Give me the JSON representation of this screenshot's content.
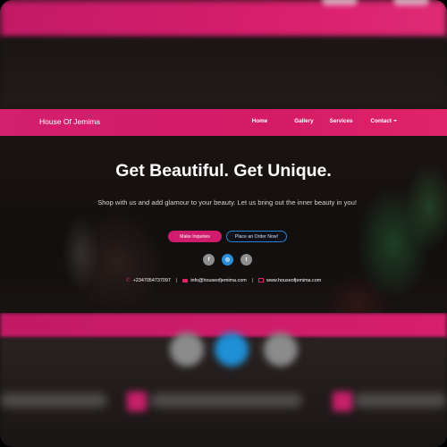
{
  "navbar": {
    "brand": "House Of Jemima",
    "links": [
      "Home",
      "Gallery",
      "Services",
      "Contact"
    ]
  },
  "hero": {
    "title": "Get Beautiful. Get Unique.",
    "subtitle": "Shop with us and add glamour to your beauty. Let us bring out the inner beauty in you!",
    "buttons": {
      "inquiries": "Make Inquiries",
      "order": "Place an Order Now!"
    }
  },
  "social": {
    "facebook": "f",
    "instagram": "◎",
    "twitter": "t"
  },
  "contact": {
    "phone": "+2347054737097",
    "separator": "|",
    "email": "info@houseofjemima.com",
    "website": "www.houseofjemima.com"
  },
  "icons": {
    "phone": "phone-icon",
    "email": "envelope-icon",
    "website": "desktop-icon"
  },
  "colors": {
    "brand_pink": "#d21f6e",
    "accent_blue": "#2a8fd8"
  }
}
